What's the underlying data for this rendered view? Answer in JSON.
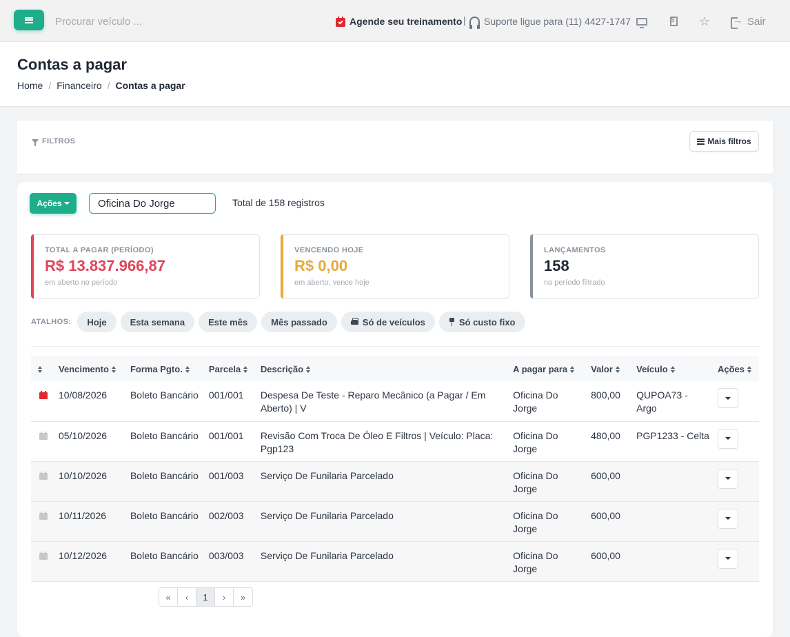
{
  "topbar": {
    "search_placeholder": "Procurar veículo ...",
    "training_link": "Agende seu treinamento",
    "separator": "|",
    "support_text": "Suporte ligue para (11) 4427-1747",
    "logout_label": "Sair",
    "icons": [
      "menu-icon",
      "calendar-check-icon",
      "headset-icon",
      "monitor-icon",
      "invoice-icon",
      "star-icon",
      "logout-icon"
    ]
  },
  "page": {
    "title": "Contas a pagar",
    "breadcrumb": [
      "Home",
      "Financeiro",
      "Contas a pagar"
    ]
  },
  "filters": {
    "label": "FILTROS",
    "more_button": "Mais filtros"
  },
  "toolbar": {
    "actions_button": "Ações",
    "search_value": "Oficina Do Jorge",
    "total_text": "Total de 158 registros"
  },
  "stats": [
    {
      "label": "TOTAL A PAGAR (PERÍODO)",
      "value": "R$ 13.837.966,87",
      "sub": "em aberto no período",
      "color": "#e0455a"
    },
    {
      "label": "VENCENDO HOJE",
      "value": "R$ 0,00",
      "sub": "em aberto, vence hoje",
      "color": "#e8a93a"
    },
    {
      "label": "LANÇAMENTOS",
      "value": "158",
      "sub": "no período filtrado",
      "color": "#8b939e"
    }
  ],
  "shortcuts": {
    "label": "ATALHOS:",
    "items": [
      "Hoje",
      "Esta semana",
      "Este mês",
      "Mês passado",
      "Só de veículos",
      "Só custo fixo"
    ]
  },
  "table": {
    "headers": [
      "Vencimento",
      "Forma Pgto.",
      "Parcela",
      "Descrição",
      "A pagar para",
      "Valor",
      "Veículo",
      "Ações"
    ],
    "rows": [
      {
        "due_icon": "red",
        "due": "10/08/2026",
        "method": "Boleto Bancário",
        "installment": "001/001",
        "description": "Despesa De Teste - Reparo Mecânico (a Pagar / Em Aberto) | V",
        "payee": "Oficina Do Jorge",
        "amount": "800,00",
        "vehicle": "QUPOA73 - Argo"
      },
      {
        "due_icon": "gray",
        "due": "05/10/2026",
        "method": "Boleto Bancário",
        "installment": "001/001",
        "description": "Revisão Com Troca De Óleo E Filtros | Veículo: Placa: Pgp123",
        "payee": "Oficina Do Jorge",
        "amount": "480,00",
        "vehicle": "PGP1233 - Celta"
      },
      {
        "due_icon": "gray",
        "due": "10/10/2026",
        "method": "Boleto Bancário",
        "installment": "001/003",
        "description": "Serviço De Funilaria Parcelado",
        "payee": "Oficina Do Jorge",
        "amount": "600,00",
        "vehicle": ""
      },
      {
        "due_icon": "gray",
        "due": "10/11/2026",
        "method": "Boleto Bancário",
        "installment": "002/003",
        "description": "Serviço De Funilaria Parcelado",
        "payee": "Oficina Do Jorge",
        "amount": "600,00",
        "vehicle": ""
      },
      {
        "due_icon": "gray",
        "due": "10/12/2026",
        "method": "Boleto Bancário",
        "installment": "003/003",
        "description": "Serviço De Funilaria Parcelado",
        "payee": "Oficina Do Jorge",
        "amount": "600,00",
        "vehicle": ""
      }
    ]
  },
  "pagination": {
    "first": "«",
    "prev": "‹",
    "current": "1",
    "next": "›",
    "last": "»"
  },
  "colors": {
    "brand": "#1fae8c",
    "danger": "#e0282d",
    "muted_icon": "#c4c9cf"
  }
}
